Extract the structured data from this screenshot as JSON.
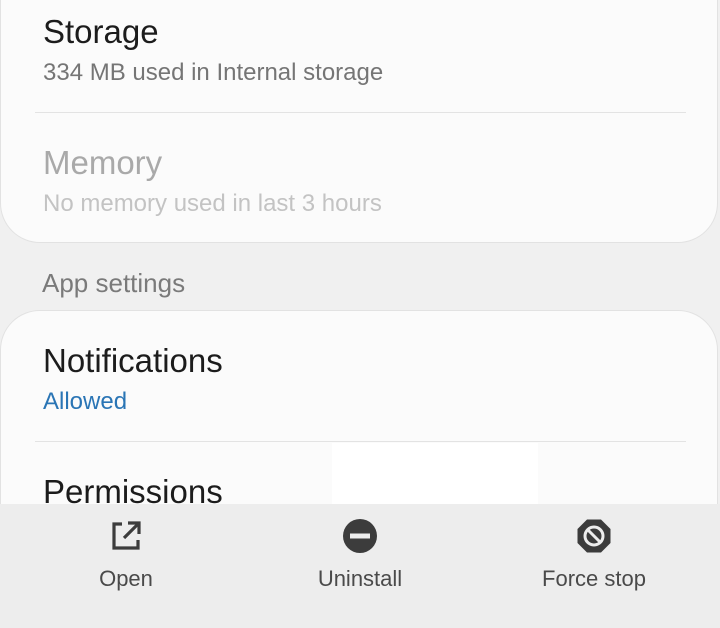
{
  "storage": {
    "title": "Storage",
    "subtitle": "334 MB used in Internal storage"
  },
  "memory": {
    "title": "Memory",
    "subtitle": "No memory used in last 3 hours"
  },
  "section_header": "App settings",
  "notifications": {
    "title": "Notifications",
    "subtitle": "Allowed"
  },
  "permissions": {
    "title": "Permissions"
  },
  "actions": [
    {
      "label": "Open",
      "icon": "open-external-icon"
    },
    {
      "label": "Uninstall",
      "icon": "uninstall-icon"
    },
    {
      "label": "Force stop",
      "icon": "force-stop-icon"
    }
  ],
  "colors": {
    "accent": "#2a75b5",
    "background": "#f0f0f0",
    "card": "#fbfbfb",
    "icon": "#3c3c3c"
  }
}
